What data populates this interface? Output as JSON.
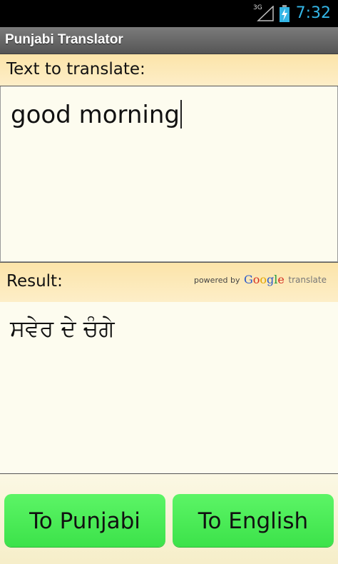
{
  "status_bar": {
    "network": "3G",
    "time": "7:32",
    "signal_icon": "signal-icon",
    "battery_icon": "battery-charging-icon"
  },
  "app": {
    "title": "Punjabi Translator"
  },
  "input_section": {
    "label": "Text to translate:",
    "value": "good morning"
  },
  "result_section": {
    "label": "Result:",
    "value": "ਸਵੇਰ ਦੇ ਚੰਗੇ",
    "powered_by": "powered by",
    "google_letters": [
      "G",
      "o",
      "o",
      "g",
      "l",
      "e"
    ],
    "translate_word": "translate"
  },
  "buttons": {
    "to_punjabi": "To Punjabi",
    "to_english": "To English"
  },
  "colors": {
    "accent_time": "#33b5e5",
    "button_green": "#4ded58",
    "header_bar": "#fce4a9"
  }
}
